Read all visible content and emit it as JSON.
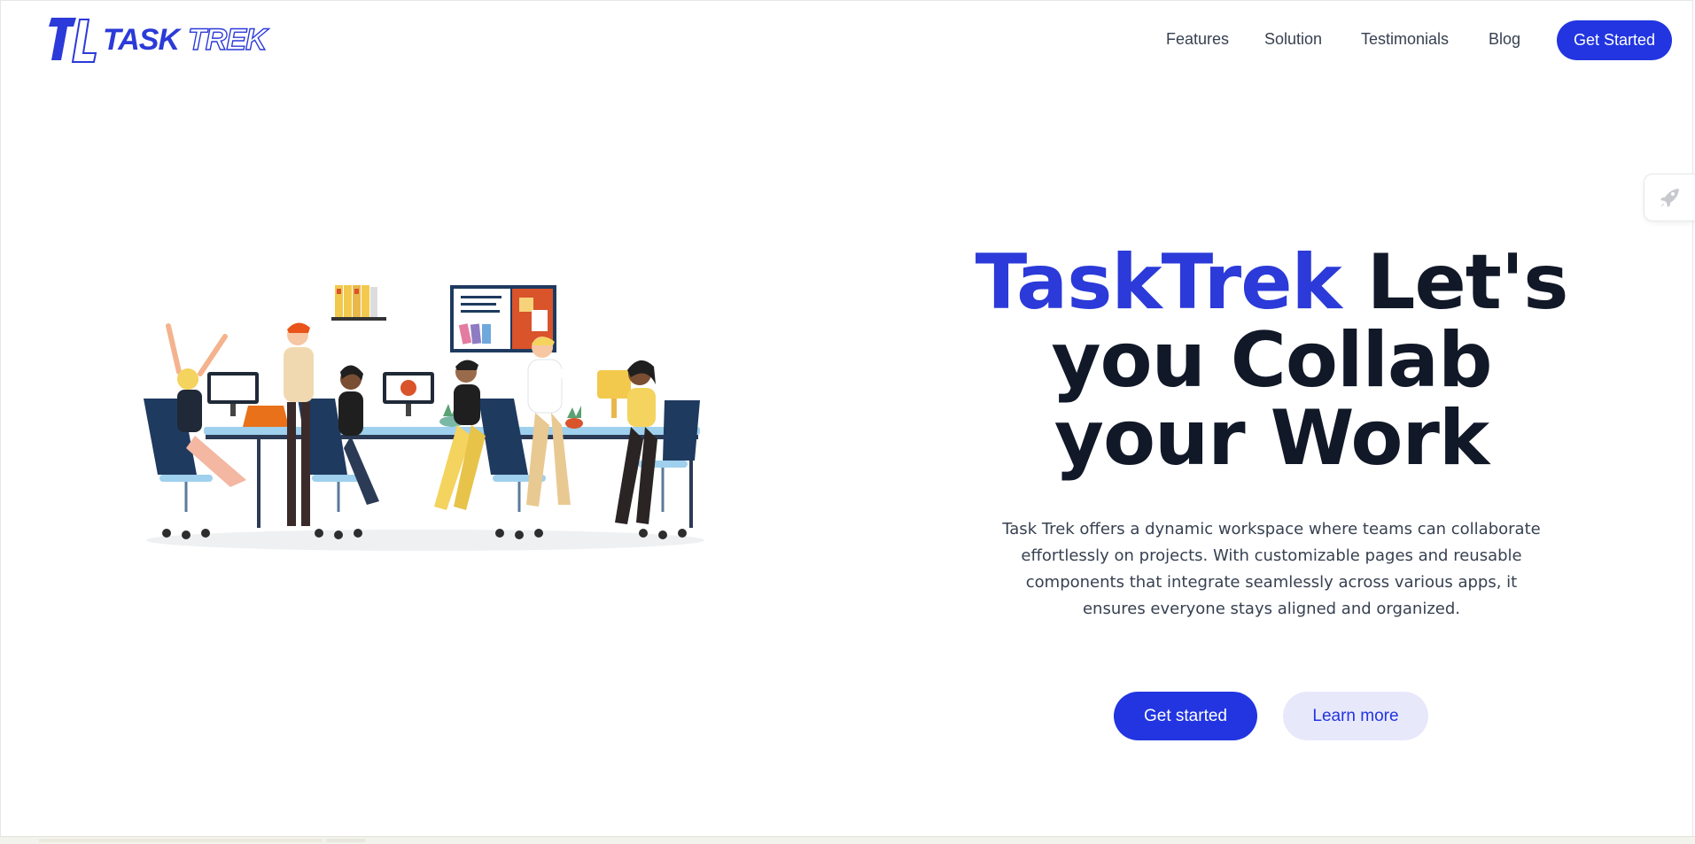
{
  "brand": {
    "word1": "TASK",
    "word2": "TREK",
    "color": "#2b3ad8"
  },
  "nav": {
    "items": [
      {
        "label": "Features"
      },
      {
        "label": "Solution"
      },
      {
        "label": "Testimonials"
      },
      {
        "label": "Blog"
      }
    ],
    "cta_label": "Get Started"
  },
  "hero": {
    "title_brand": "TaskTrek",
    "title_rest_1": " Let's",
    "title_line_2": "you Collab",
    "title_line_3": "your Work",
    "description": "Task Trek offers a dynamic workspace where teams can collaborate effortlessly on projects. With customizable pages and reusable components that integrate seamlessly across various apps, it ensures everyone stays aligned and organized.",
    "primary_button": "Get started",
    "secondary_button": "Learn more",
    "illustration": "team-collaboration-illustration"
  },
  "side_widget": {
    "icon": "rocket-icon"
  },
  "colors": {
    "accent": "#2235e0",
    "heading": "#111827",
    "body_text": "#374151",
    "secondary_button_bg": "#e8e8fb"
  }
}
